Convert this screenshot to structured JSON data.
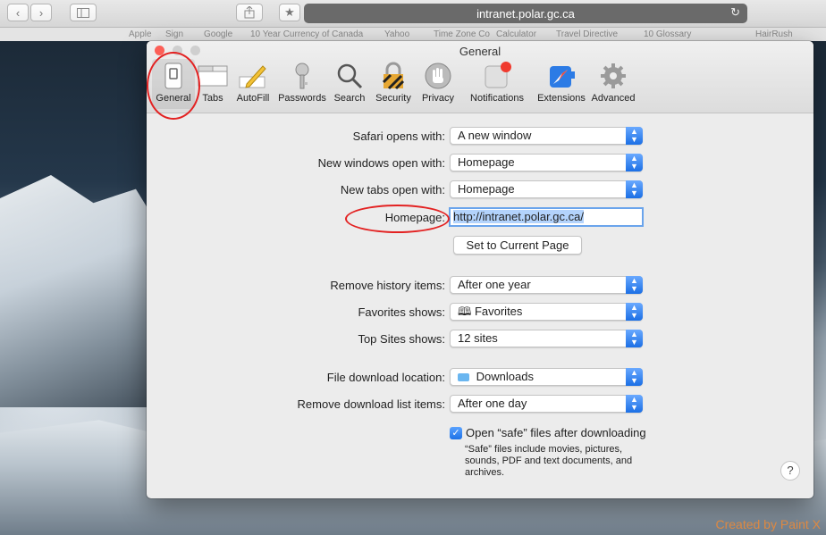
{
  "browser": {
    "address": "intranet.polar.gc.ca",
    "bookmarks": [
      "Apple",
      "Sign",
      "Google",
      "10 Year Currency of Canada",
      "Yahoo",
      "Time Zone Co",
      "Calculator",
      "Travel Directive",
      "10 Glossary",
      "HairRush"
    ]
  },
  "prefs": {
    "title": "General",
    "tabs": [
      {
        "label": "General",
        "icon": "general-switch-icon"
      },
      {
        "label": "Tabs",
        "icon": "tabs-icon"
      },
      {
        "label": "AutoFill",
        "icon": "autofill-pencil-icon"
      },
      {
        "label": "Passwords",
        "icon": "key-icon"
      },
      {
        "label": "Search",
        "icon": "search-icon"
      },
      {
        "label": "Security",
        "icon": "lock-icon"
      },
      {
        "label": "Privacy",
        "icon": "hand-icon"
      },
      {
        "label": "Notifications",
        "icon": "notification-icon"
      },
      {
        "label": "Extensions",
        "icon": "compass-icon"
      },
      {
        "label": "Advanced",
        "icon": "gear-icon"
      }
    ],
    "rows": {
      "safari_opens_with": {
        "label": "Safari opens with:",
        "value": "A new window"
      },
      "new_windows": {
        "label": "New windows open with:",
        "value": "Homepage"
      },
      "new_tabs": {
        "label": "New tabs open with:",
        "value": "Homepage"
      },
      "homepage": {
        "label": "Homepage:",
        "value": "http://intranet.polar.gc.ca/"
      },
      "set_current": "Set to Current Page",
      "remove_history": {
        "label": "Remove history items:",
        "value": "After one year"
      },
      "favorites_shows": {
        "label": "Favorites shows:",
        "value": "Favorites"
      },
      "top_sites": {
        "label": "Top Sites shows:",
        "value": "12 sites"
      },
      "download_location": {
        "label": "File download location:",
        "value": "Downloads"
      },
      "remove_download": {
        "label": "Remove download list items:",
        "value": "After one day"
      },
      "open_safe": {
        "label": "Open “safe” files after downloading",
        "checked": true,
        "note_lines": [
          "“Safe” files include movies, pictures,",
          "sounds, PDF and text documents, and",
          "archives."
        ]
      }
    },
    "help": "?"
  },
  "watermark": "Created by Paint X",
  "colors": {
    "accent": "#1b6fe5",
    "annotation": "#e32222",
    "watermark": "#e98a3a"
  }
}
